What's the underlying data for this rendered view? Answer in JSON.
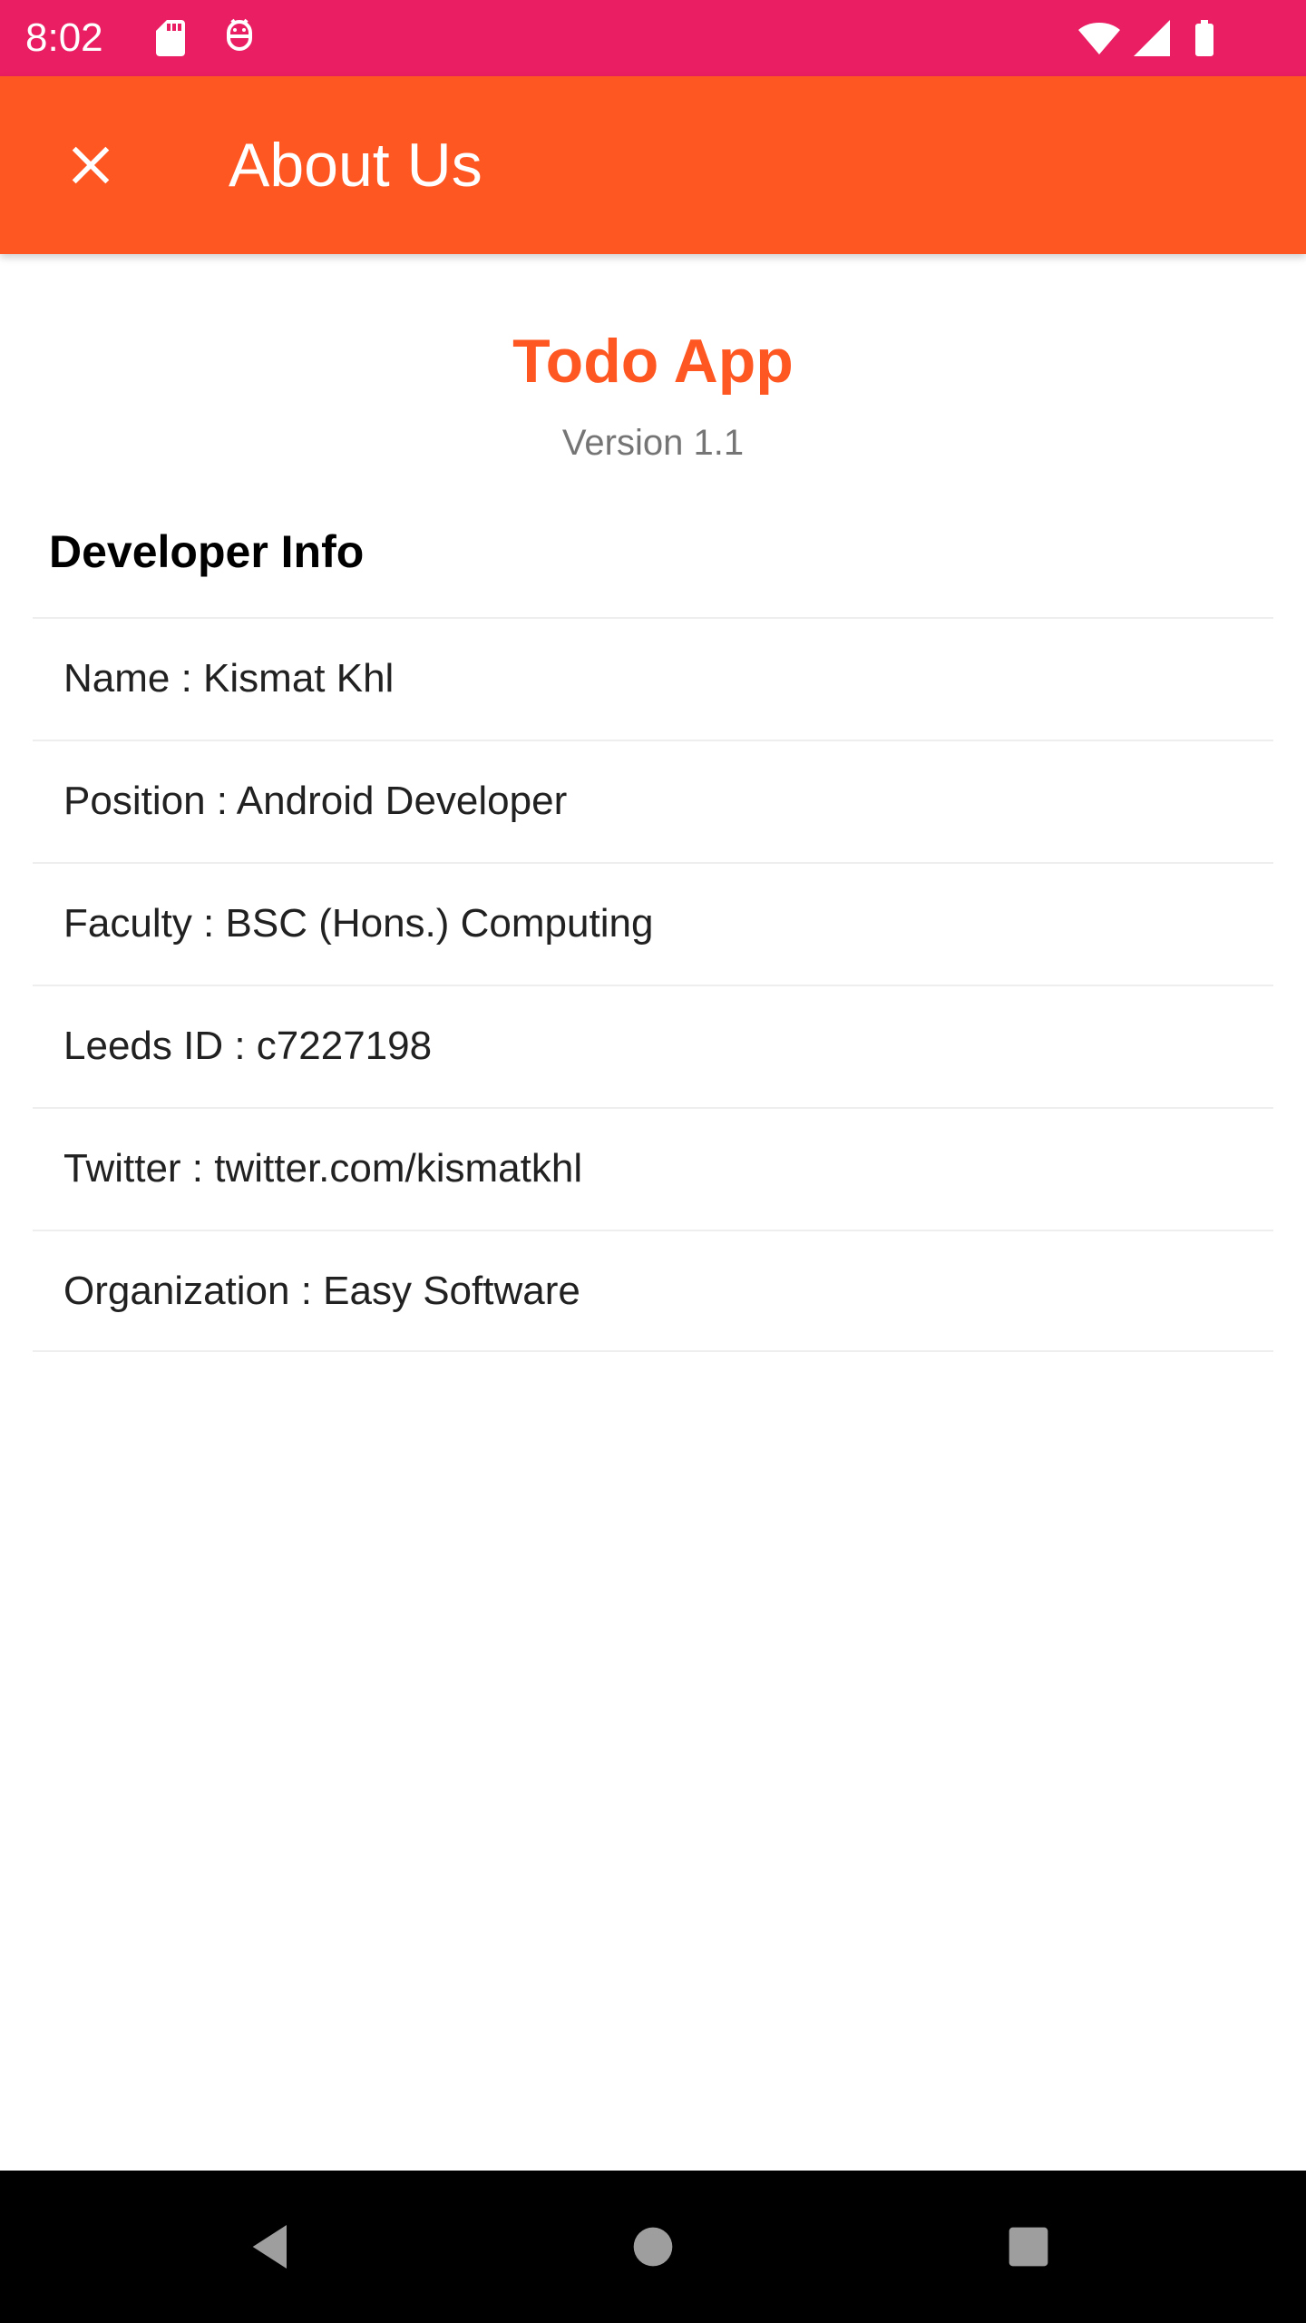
{
  "status_bar": {
    "time": "8:02",
    "left_icons": [
      "sd-card-icon",
      "android-debug-icon"
    ],
    "right_icons": [
      "wifi-icon",
      "cell-signal-icon",
      "battery-icon"
    ],
    "background": "#E91E63"
  },
  "app_bar": {
    "title": "About Us",
    "close_icon": "close-icon",
    "background": "#FF5722"
  },
  "about": {
    "app_name": "Todo App",
    "version": "Version 1.1",
    "accent": "#FF5722"
  },
  "developer_info": {
    "heading": "Developer Info",
    "items": [
      "Name : Kismat Khl",
      "Position : Android Developer",
      "Faculty : BSC (Hons.) Computing",
      "Leeds ID : c7227198",
      "Twitter : twitter.com/kismatkhl",
      "Organization : Easy Software"
    ]
  },
  "nav_bar": {
    "buttons": [
      "back-icon",
      "home-icon",
      "recents-icon"
    ]
  }
}
